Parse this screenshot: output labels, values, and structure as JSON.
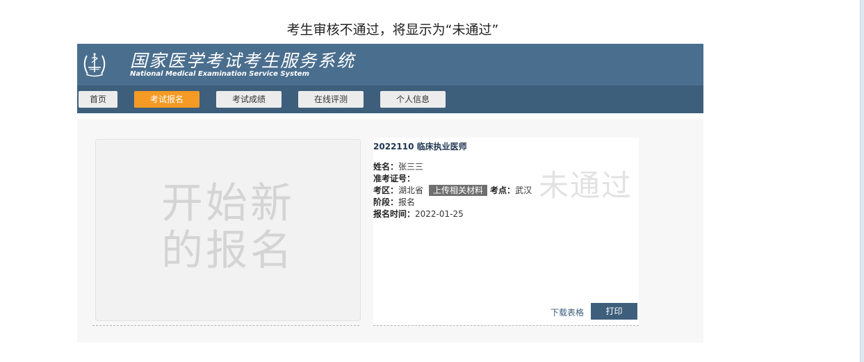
{
  "caption": "考生审核不通过，将显示为“未通过”",
  "header": {
    "title_cn": "国家医学考试考生服务系统",
    "title_en": "National Medical Examination Service System",
    "emblem_icon": "medical-exam-emblem-icon"
  },
  "nav": {
    "tabs": [
      {
        "label": "首页",
        "active": false
      },
      {
        "label": "考试报名",
        "active": true
      },
      {
        "label": "考试成绩",
        "active": false
      },
      {
        "label": "在线评测",
        "active": false
      },
      {
        "label": "个人信息",
        "active": false
      }
    ]
  },
  "new_registration": {
    "line1": "开始新",
    "line2": "的报名"
  },
  "record": {
    "title": "2022110 临床执业医师",
    "name_label": "姓名：",
    "name_value": "张三三",
    "ticket_label": "准考证号：",
    "ticket_value": "",
    "region_label": "考区：",
    "region_value": "湖北省",
    "upload_button": "上传相关材料",
    "site_label": "考点：",
    "site_value": "武汉",
    "stage_label": "阶段：",
    "stage_value": "报名",
    "time_label": "报名时间：",
    "time_value": "2022-01-25",
    "status_stamp": "未通过",
    "download_link": "下载表格",
    "print_button": "打印"
  },
  "colors": {
    "banner": "#4a6e8e",
    "navbar": "#3e5f7c",
    "active_tab": "#f49a25"
  }
}
